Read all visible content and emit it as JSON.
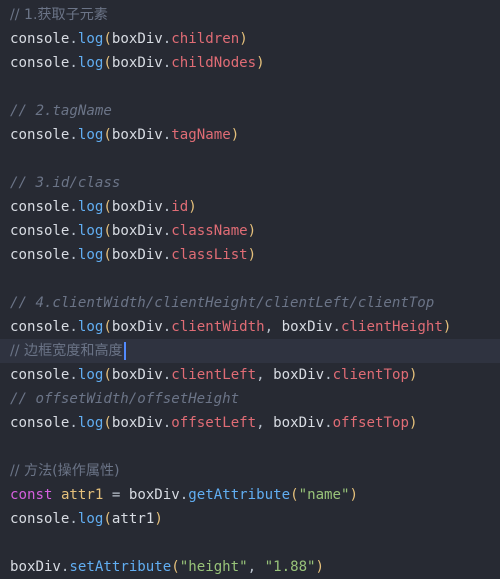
{
  "editor": {
    "lines": [
      {
        "type": "comment",
        "text": "// 1.获取子元素"
      },
      {
        "type": "code",
        "obj": "console",
        "dot": ".",
        "method": "log",
        "open": "(",
        "arg_obj": "boxDiv",
        "arg_dot": ".",
        "arg_prop": "children",
        "close": ")"
      },
      {
        "type": "code",
        "obj": "console",
        "dot": ".",
        "method": "log",
        "open": "(",
        "arg_obj": "boxDiv",
        "arg_dot": ".",
        "arg_prop": "childNodes",
        "close": ")"
      },
      {
        "type": "blank"
      },
      {
        "type": "comment",
        "text": "// 2.tagName"
      },
      {
        "type": "code",
        "obj": "console",
        "dot": ".",
        "method": "log",
        "open": "(",
        "arg_obj": "boxDiv",
        "arg_dot": ".",
        "arg_prop": "tagName",
        "close": ")"
      },
      {
        "type": "blank"
      },
      {
        "type": "comment",
        "text": "// 3.id/class"
      },
      {
        "type": "code",
        "obj": "console",
        "dot": ".",
        "method": "log",
        "open": "(",
        "arg_obj": "boxDiv",
        "arg_dot": ".",
        "arg_prop": "id",
        "close": ")"
      },
      {
        "type": "code",
        "obj": "console",
        "dot": ".",
        "method": "log",
        "open": "(",
        "arg_obj": "boxDiv",
        "arg_dot": ".",
        "arg_prop": "className",
        "close": ")"
      },
      {
        "type": "code",
        "obj": "console",
        "dot": ".",
        "method": "log",
        "open": "(",
        "arg_obj": "boxDiv",
        "arg_dot": ".",
        "arg_prop": "classList",
        "close": ")"
      },
      {
        "type": "blank"
      },
      {
        "type": "comment",
        "text": "// 4.clientWidth/clientHeight/clientLeft/clientTop"
      },
      {
        "type": "code2",
        "obj": "console",
        "dot": ".",
        "method": "log",
        "open": "(",
        "arg_obj": "boxDiv",
        "arg_dot": ".",
        "arg_prop": "clientWidth",
        "comma": ", ",
        "arg2_obj": "boxDiv",
        "arg2_dot": ".",
        "arg2_prop": "clientHeight",
        "close": ")"
      },
      {
        "type": "comment",
        "text": "// 边框宽度和高度",
        "current": true
      },
      {
        "type": "code2",
        "obj": "console",
        "dot": ".",
        "method": "log",
        "open": "(",
        "arg_obj": "boxDiv",
        "arg_dot": ".",
        "arg_prop": "clientLeft",
        "comma": ", ",
        "arg2_obj": "boxDiv",
        "arg2_dot": ".",
        "arg2_prop": "clientTop",
        "close": ")"
      },
      {
        "type": "comment",
        "text": "// offsetWidth/offsetHeight"
      },
      {
        "type": "code2",
        "obj": "console",
        "dot": ".",
        "method": "log",
        "open": "(",
        "arg_obj": "boxDiv",
        "arg_dot": ".",
        "arg_prop": "offsetLeft",
        "comma": ", ",
        "arg2_obj": "boxDiv",
        "arg2_dot": ".",
        "arg2_prop": "offsetTop",
        "close": ")"
      },
      {
        "type": "blank"
      },
      {
        "type": "comment",
        "text": "// 方法(操作属性)"
      },
      {
        "type": "decl",
        "keyword": "const",
        "var": "attr1",
        "eq": " = ",
        "obj": "boxDiv",
        "dot": ".",
        "method": "getAttribute",
        "open": "(",
        "string": "\"name\"",
        "close": ")"
      },
      {
        "type": "code",
        "obj": "console",
        "dot": ".",
        "method": "log",
        "open": "(",
        "arg_obj": "attr1",
        "arg_dot": "",
        "arg_prop": "",
        "close": ")"
      },
      {
        "type": "blank"
      },
      {
        "type": "call2",
        "obj": "boxDiv",
        "dot": ".",
        "method": "setAttribute",
        "open": "(",
        "string": "\"height\"",
        "comma": ", ",
        "string2": "\"1.88\"",
        "close": ")"
      }
    ]
  },
  "colors": {
    "background": "#272a33",
    "comment": "#6b7487",
    "method": "#61aef2",
    "property": "#e06c75",
    "keyword": "#d55fde",
    "string": "#98c379",
    "caret": "#528bff"
  }
}
